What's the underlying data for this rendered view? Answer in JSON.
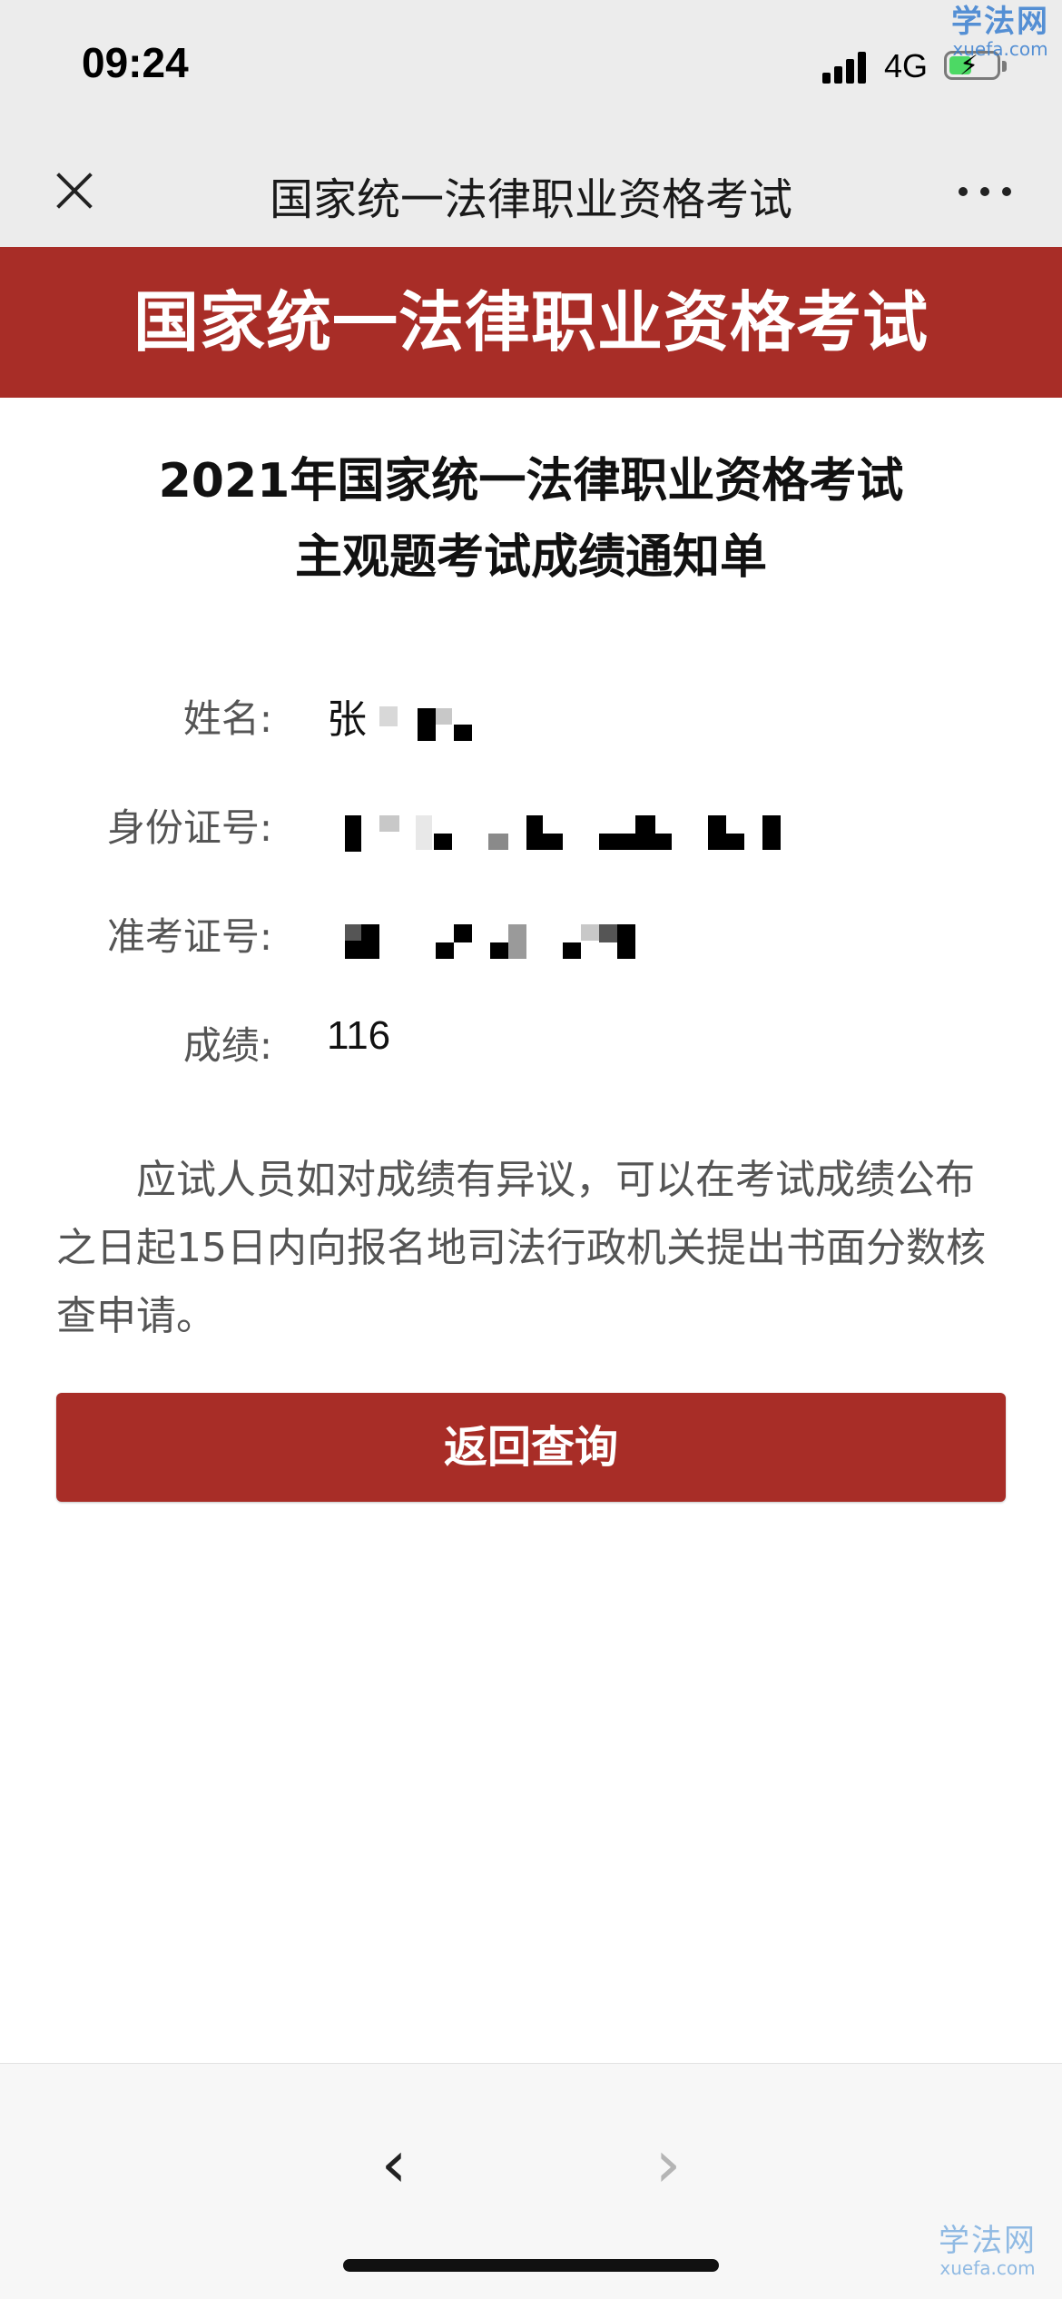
{
  "status_bar": {
    "time": "09:24",
    "network": "4G",
    "icons": [
      "signal-icon",
      "battery-charging-icon"
    ]
  },
  "watermark": {
    "cn": "学法网",
    "en": "xuefa.com"
  },
  "nav_bar": {
    "title": "国家统一法律职业资格考试",
    "icons": [
      "close-icon",
      "more-icon"
    ]
  },
  "banner": {
    "title": "国家统一法律职业资格考试"
  },
  "heading": {
    "line1": "2021年国家统一法律职业资格考试",
    "line2": "主观题考试成绩通知单"
  },
  "info": {
    "name_label": "姓名:",
    "name_value": "张",
    "id_label": "身份证号:",
    "admission_label": "准考证号:",
    "score_label": "成绩:",
    "score_value": "116"
  },
  "notice": {
    "text": "应试人员如对成绩有异议，可以在考试成绩公布之日起15日内向报名地司法行政机关提出书面分数核查申请。"
  },
  "button": {
    "label": "返回查询"
  },
  "bottom_bar": {
    "back_icon": "chevron-left-icon",
    "forward_icon": "chevron-right-icon"
  }
}
